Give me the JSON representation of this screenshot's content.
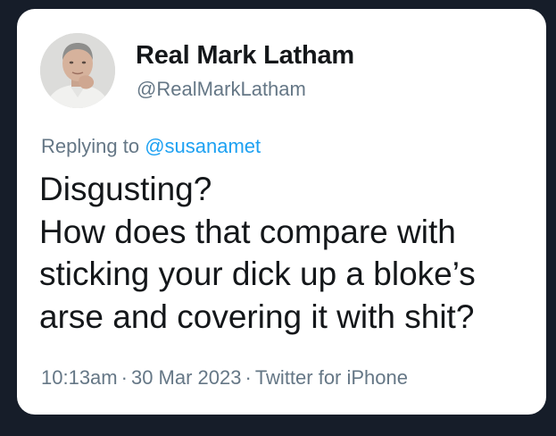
{
  "author": {
    "display_name": "Real Mark Latham",
    "handle": "@RealMarkLatham"
  },
  "reply": {
    "prefix": "Replying to",
    "mention": "@susanamet"
  },
  "tweet": {
    "lines": [
      "Disgusting?",
      "How does that compare with",
      "sticking your dick up a bloke’s",
      "arse and covering it with shit?"
    ]
  },
  "meta": {
    "time": "10:13am",
    "date": "30 Mar 2023",
    "source": "Twitter for iPhone",
    "separator": "·"
  },
  "colors": {
    "background": "#161d29",
    "card": "#ffffff",
    "text": "#14171a",
    "secondary": "#657786",
    "link": "#1da1f2"
  }
}
